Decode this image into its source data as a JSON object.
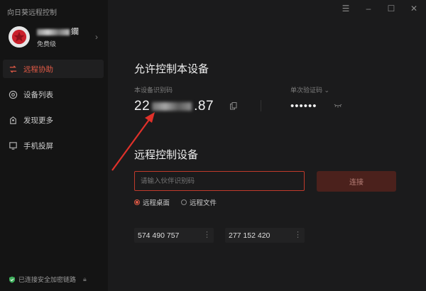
{
  "app": {
    "title": "向日葵远程控制"
  },
  "profile": {
    "username_suffix": "鑭",
    "tier": "免费级"
  },
  "nav": [
    {
      "label": "远程协助",
      "icon": "remote-assist-icon",
      "active": true
    },
    {
      "label": "设备列表",
      "icon": "device-list-icon",
      "active": false
    },
    {
      "label": "发现更多",
      "icon": "discover-icon",
      "active": false
    },
    {
      "label": "手机投屏",
      "icon": "screen-mirror-icon",
      "active": false
    }
  ],
  "footer": {
    "status": "已连接安全加密链路"
  },
  "allow": {
    "title": "允许控制本设备",
    "code_label": "本设备识别码",
    "code_prefix": "22",
    "code_suffix": ".87",
    "password_label": "单次验证码",
    "password_masked": "••••••"
  },
  "control": {
    "title": "远程控制设备",
    "input_placeholder": "请输入伙伴识别码",
    "connect_label": "连接",
    "modes": [
      {
        "label": "远程桌面",
        "selected": true
      },
      {
        "label": "远程文件",
        "selected": false
      }
    ],
    "recent": [
      "574 490 757",
      "277 152 420"
    ]
  },
  "colors": {
    "accent": "#e05a46",
    "sidebar": "#141414",
    "main": "#1b1b1c"
  }
}
